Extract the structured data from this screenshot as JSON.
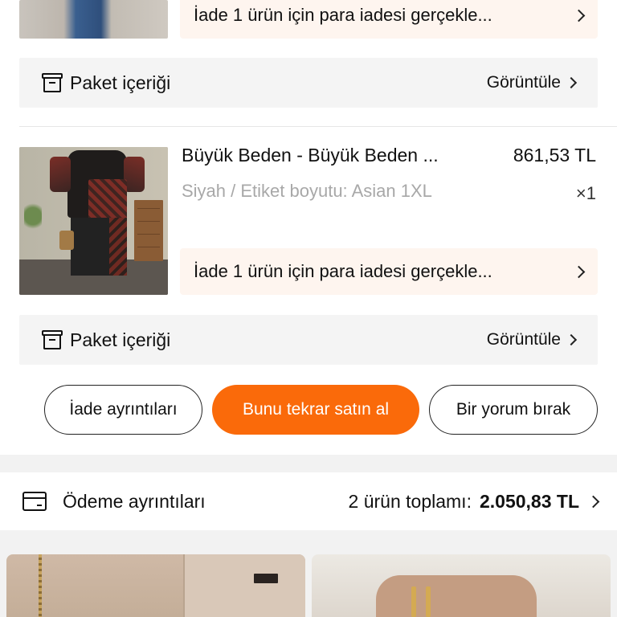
{
  "order_items": [
    {
      "return_text": "İade 1 ürün için para iadesi gerçekle...",
      "package": {
        "label": "Paket içeriği",
        "view_label": "Görüntüle"
      }
    },
    {
      "title": "Büyük Beden - Büyük Beden ...",
      "price": "861,53 TL",
      "variant": "Siyah / Etiket boyutu: Asian 1XL",
      "quantity": "×1",
      "return_text": "İade 1 ürün için para iadesi gerçekle...",
      "package": {
        "label": "Paket içeriği",
        "view_label": "Görüntüle"
      }
    }
  ],
  "actions": {
    "return_details": "İade ayrıntıları",
    "buy_again": "Bunu tekrar satın al",
    "leave_review": "Bir yorum bırak"
  },
  "payment": {
    "label": "Ödeme ayrıntıları",
    "summary": "2 ürün toplamı:",
    "total": "2.050,83 TL"
  },
  "colors": {
    "accent": "#fa6a0a",
    "return_bg": "#fef5ef",
    "row_bg": "#f4f4f4"
  }
}
